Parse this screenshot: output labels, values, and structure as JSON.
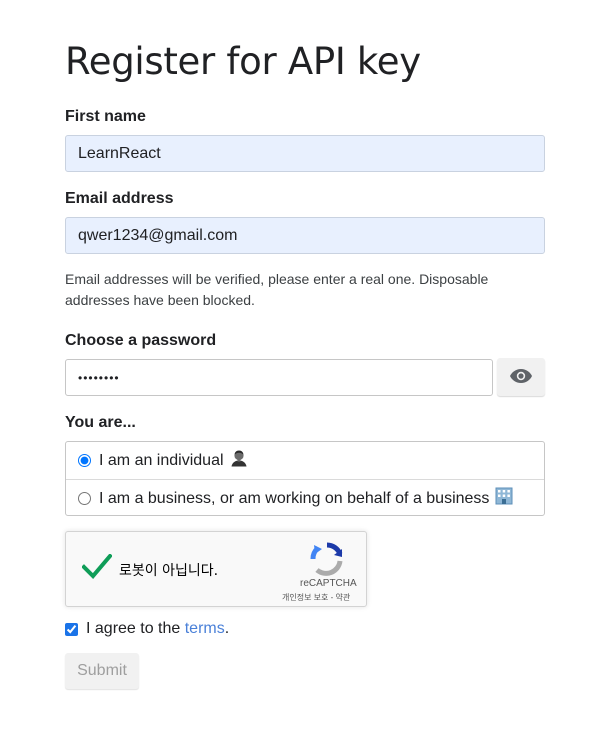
{
  "page": {
    "title": "Register for API key"
  },
  "form": {
    "first_name": {
      "label": "First name",
      "value": "LearnReact"
    },
    "email": {
      "label": "Email address",
      "value": "qwer1234@gmail.com",
      "hint": "Email addresses will be verified, please enter a real one. Disposable addresses have been blocked."
    },
    "password": {
      "label": "Choose a password",
      "value": "••••••••",
      "toggle_icon": "eye-icon"
    },
    "user_type": {
      "label": "You are...",
      "options": [
        {
          "label": "I am an individual",
          "icon": "person-emoji",
          "selected": true
        },
        {
          "label": "I am a business, or am working on behalf of a business",
          "icon": "office-building-emoji",
          "selected": false
        }
      ]
    },
    "captcha": {
      "label": "로봇이 아닙니다.",
      "brand": "reCAPTCHA",
      "privacy": "개인정보 보호",
      "separator": " - ",
      "terms": "약관",
      "checked": true
    },
    "agree": {
      "prefix": "I agree to the ",
      "link": "terms",
      "suffix": ".",
      "checked": true
    },
    "submit_label": "Submit"
  },
  "colors": {
    "autofill_bg": "#e8f0fe",
    "link": "#4a80d8",
    "check_green": "#0f9d58",
    "captcha_blue": "#1c3aa9"
  }
}
